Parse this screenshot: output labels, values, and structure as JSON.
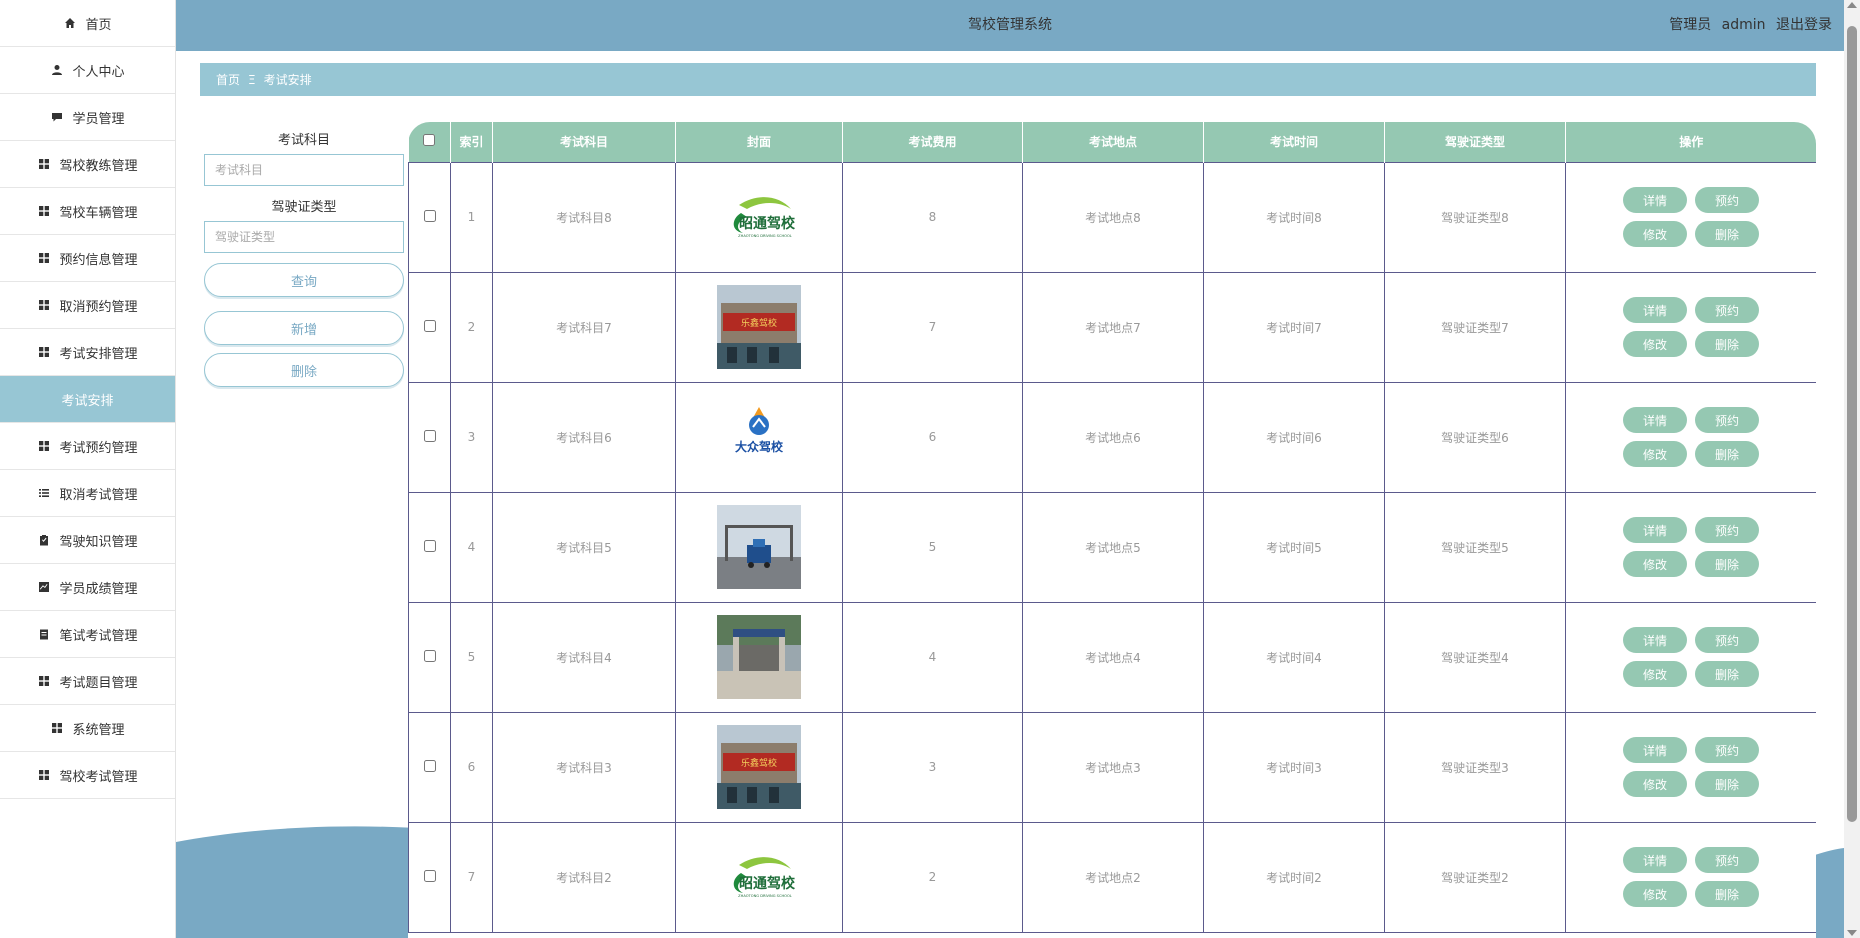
{
  "sidebar": {
    "items": [
      {
        "label": "首页",
        "icon": "home-icon"
      },
      {
        "label": "个人中心",
        "icon": "user-icon"
      },
      {
        "label": "学员管理",
        "icon": "chat-icon"
      },
      {
        "label": "驾校教练管理",
        "icon": "grid-icon"
      },
      {
        "label": "驾校车辆管理",
        "icon": "grid-icon"
      },
      {
        "label": "预约信息管理",
        "icon": "grid-icon"
      },
      {
        "label": "取消预约管理",
        "icon": "grid-icon"
      },
      {
        "label": "考试安排管理",
        "icon": "grid-icon"
      },
      {
        "label": "考试安排",
        "icon": "",
        "active": true
      },
      {
        "label": "考试预约管理",
        "icon": "grid-icon"
      },
      {
        "label": "取消考试管理",
        "icon": "list-icon"
      },
      {
        "label": "驾驶知识管理",
        "icon": "clipboard-icon"
      },
      {
        "label": "学员成绩管理",
        "icon": "chart-icon"
      },
      {
        "label": "笔试考试管理",
        "icon": "notepad-icon"
      },
      {
        "label": "考试题目管理",
        "icon": "grid-icon"
      },
      {
        "label": "系统管理",
        "icon": "grid-icon"
      },
      {
        "label": "驾校考试管理",
        "icon": "grid-icon"
      }
    ]
  },
  "header": {
    "title": "驾校管理系统",
    "user_role": "管理员",
    "username": "admin",
    "logout": "退出登录"
  },
  "breadcrumb": {
    "home": "首页",
    "separator": "Ξ",
    "current": "考试安排"
  },
  "filters": {
    "subject_label": "考试科目",
    "subject_placeholder": "考试科目",
    "license_label": "驾驶证类型",
    "license_placeholder": "驾驶证类型",
    "query_button": "查询",
    "add_button": "新增",
    "delete_button": "删除"
  },
  "table": {
    "headers": [
      "索引",
      "考试科目",
      "封面",
      "考试费用",
      "考试地点",
      "考试时间",
      "驾驶证类型",
      "操作"
    ],
    "actions": [
      "详情",
      "预约",
      "修改",
      "删除"
    ],
    "rows": [
      {
        "index": "1",
        "subject": "考试科目8",
        "cover": "zhaotong-logo",
        "fee": "8",
        "place": "考试地点8",
        "time": "考试时间8",
        "license": "驾驶证类型8"
      },
      {
        "index": "2",
        "subject": "考试科目7",
        "cover": "building-photo",
        "fee": "7",
        "place": "考试地点7",
        "time": "考试时间7",
        "license": "驾驶证类型7"
      },
      {
        "index": "3",
        "subject": "考试科目6",
        "cover": "dazhong-logo",
        "fee": "6",
        "place": "考试地点6",
        "time": "考试时间6",
        "license": "驾驶证类型6"
      },
      {
        "index": "4",
        "subject": "考试科目5",
        "cover": "truck-photo",
        "fee": "5",
        "place": "考试地点5",
        "time": "考试时间5",
        "license": "驾驶证类型5"
      },
      {
        "index": "5",
        "subject": "考试科目4",
        "cover": "gate-photo",
        "fee": "4",
        "place": "考试地点4",
        "time": "考试时间4",
        "license": "驾驶证类型4"
      },
      {
        "index": "6",
        "subject": "考试科目3",
        "cover": "building-photo",
        "fee": "3",
        "place": "考试地点3",
        "time": "考试时间3",
        "license": "驾驶证类型3"
      },
      {
        "index": "7",
        "subject": "考试科目2",
        "cover": "zhaotong-logo",
        "fee": "2",
        "place": "考试地点2",
        "time": "考试时间2",
        "license": "驾驶证类型2"
      }
    ]
  },
  "colors": {
    "topbar": "#79a9c4",
    "accent": "#97c6d4",
    "table_header": "#95c8b2",
    "row_border": "#5b5a8c"
  },
  "cover_text": {
    "zhaotong": "昭通驾校",
    "zhaotong_sub": "ZHAOTONG DRIVING SCHOOL",
    "dazhong": "大众驾校",
    "building_sign": "乐鑫驾校"
  }
}
